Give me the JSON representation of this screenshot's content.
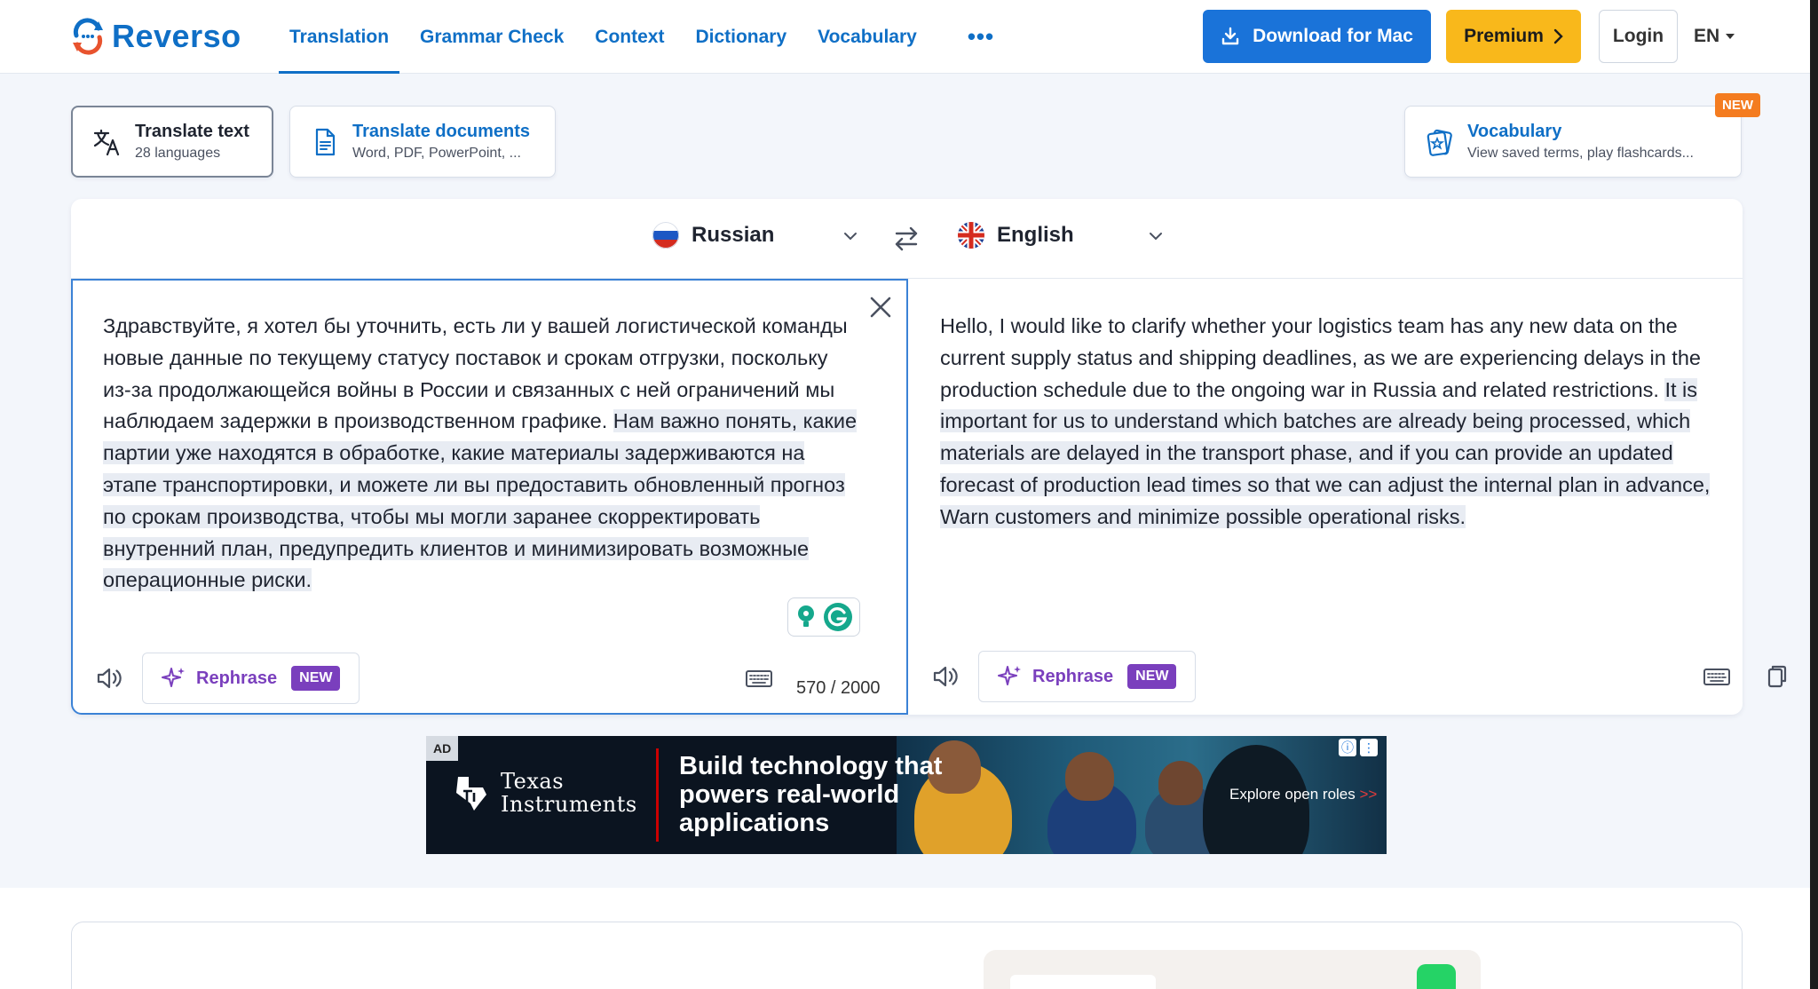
{
  "brand": {
    "name": "Reverso"
  },
  "nav": {
    "items": [
      "Translation",
      "Grammar Check",
      "Context",
      "Dictionary",
      "Vocabulary"
    ],
    "more": "•••",
    "active_index": 0
  },
  "header_actions": {
    "download_label": "Download for Mac",
    "premium_label": "Premium",
    "login_label": "Login",
    "ui_language": "EN"
  },
  "modes": {
    "translate_text": {
      "title": "Translate text",
      "subtitle": "28 languages"
    },
    "translate_docs": {
      "title": "Translate documents",
      "subtitle": "Word, PDF, PowerPoint, ..."
    },
    "vocabulary": {
      "title": "Vocabulary",
      "subtitle": "View saved terms, play flashcards...",
      "badge": "NEW"
    }
  },
  "translator": {
    "source_language": "Russian",
    "target_language": "English",
    "source_text_plain": "Здравствуйте, я хотел бы уточнить, есть ли у вашей логистической команды новые данные по текущему статусу поставок и срокам отгрузки, поскольку из-за продолжающейся войны в России и связанных с ней ограничений мы наблюдаем задержки в производственном графике.",
    "source_text_highlighted": "Нам важно понять, какие партии уже находятся в обработке, какие материалы задерживаются на этапе транспортировки, и можете ли вы предоставить обновленный прогноз по срокам производства, чтобы мы могли заранее скорректировать внутренний план, предупредить клиентов и минимизировать возможные операционные риски.",
    "target_text_plain": "Hello, I would like to clarify whether your logistics team has any new data on the current supply status and shipping deadlines, as we are experiencing delays in the production schedule due to the ongoing war in Russia and related restrictions.",
    "target_text_highlighted": "It is important for us to understand which batches are already being processed, which materials are delayed in the transport phase, and if you can provide an updated forecast of production lead times so that we can adjust the internal plan in advance, Warn customers and minimize possible operational risks.",
    "rephrase_label": "Rephrase",
    "rephrase_badge": "NEW",
    "char_count": "570 / 2000"
  },
  "ad": {
    "label": "AD",
    "brand_line1": "Texas",
    "brand_line2": "Instruments",
    "headline_1": "Build technology that",
    "headline_2": "powers real-world",
    "headline_3": "applications",
    "cta": "Explore open roles",
    "cta_arrows": ">>"
  },
  "colors": {
    "accent": "#0f6fc6",
    "download_bg": "#1a73d9",
    "premium_bg": "#f9b81b",
    "rephrase": "#7a3fbd",
    "new_badge": "#f47c20",
    "source_border": "#3b82d6"
  }
}
